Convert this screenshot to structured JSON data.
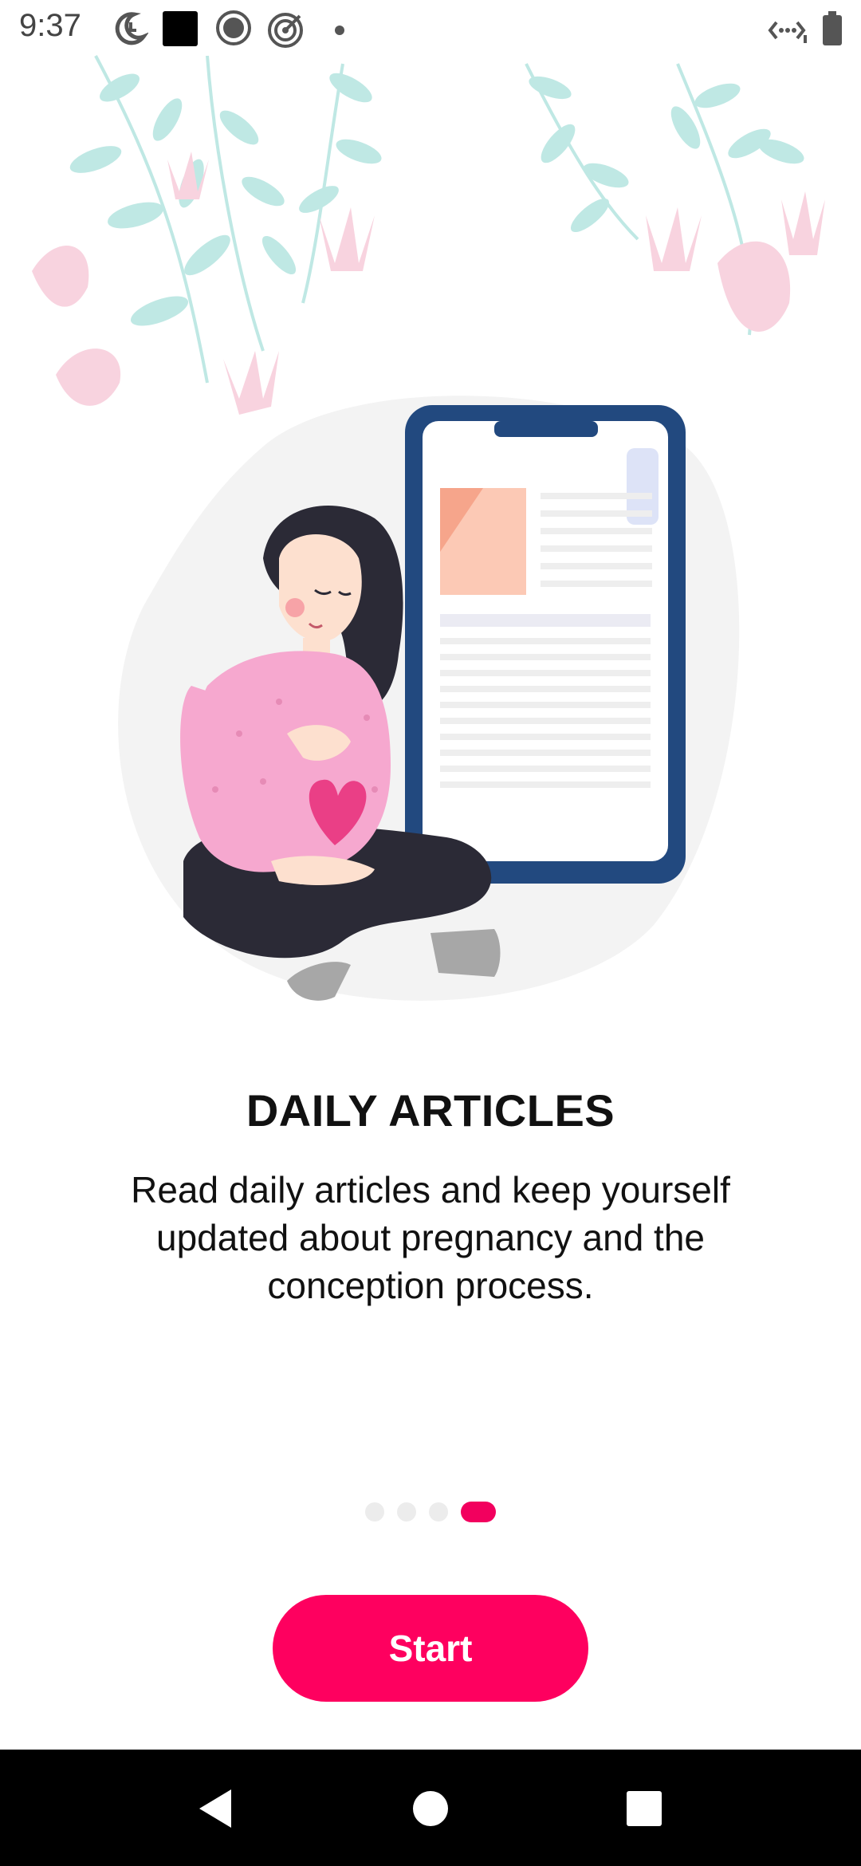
{
  "status_bar": {
    "time": "9:37",
    "left_icons": [
      "moon-clock-icon",
      "black-square-icon",
      "circle-record-icon",
      "target-icon",
      "dot-icon"
    ],
    "right_icons": [
      "data-saver-icon",
      "battery-icon"
    ]
  },
  "onboarding": {
    "title": "DAILY ARTICLES",
    "description": "Read daily articles and keep yourself updated about pregnancy and the conception process.",
    "page_count": 4,
    "active_page": 4
  },
  "start_button": {
    "label": "Start"
  },
  "nav_bar": {
    "buttons": [
      "back-icon",
      "home-icon",
      "recents-icon"
    ]
  },
  "colors": {
    "accent": "#fe005f",
    "dot_inactive": "#ececec",
    "phone_frame": "#22497f",
    "sweater": "#f6a8cf",
    "heart": "#ea3f86",
    "leaf": "#bfe8e4",
    "flower": "#f8d3df"
  }
}
